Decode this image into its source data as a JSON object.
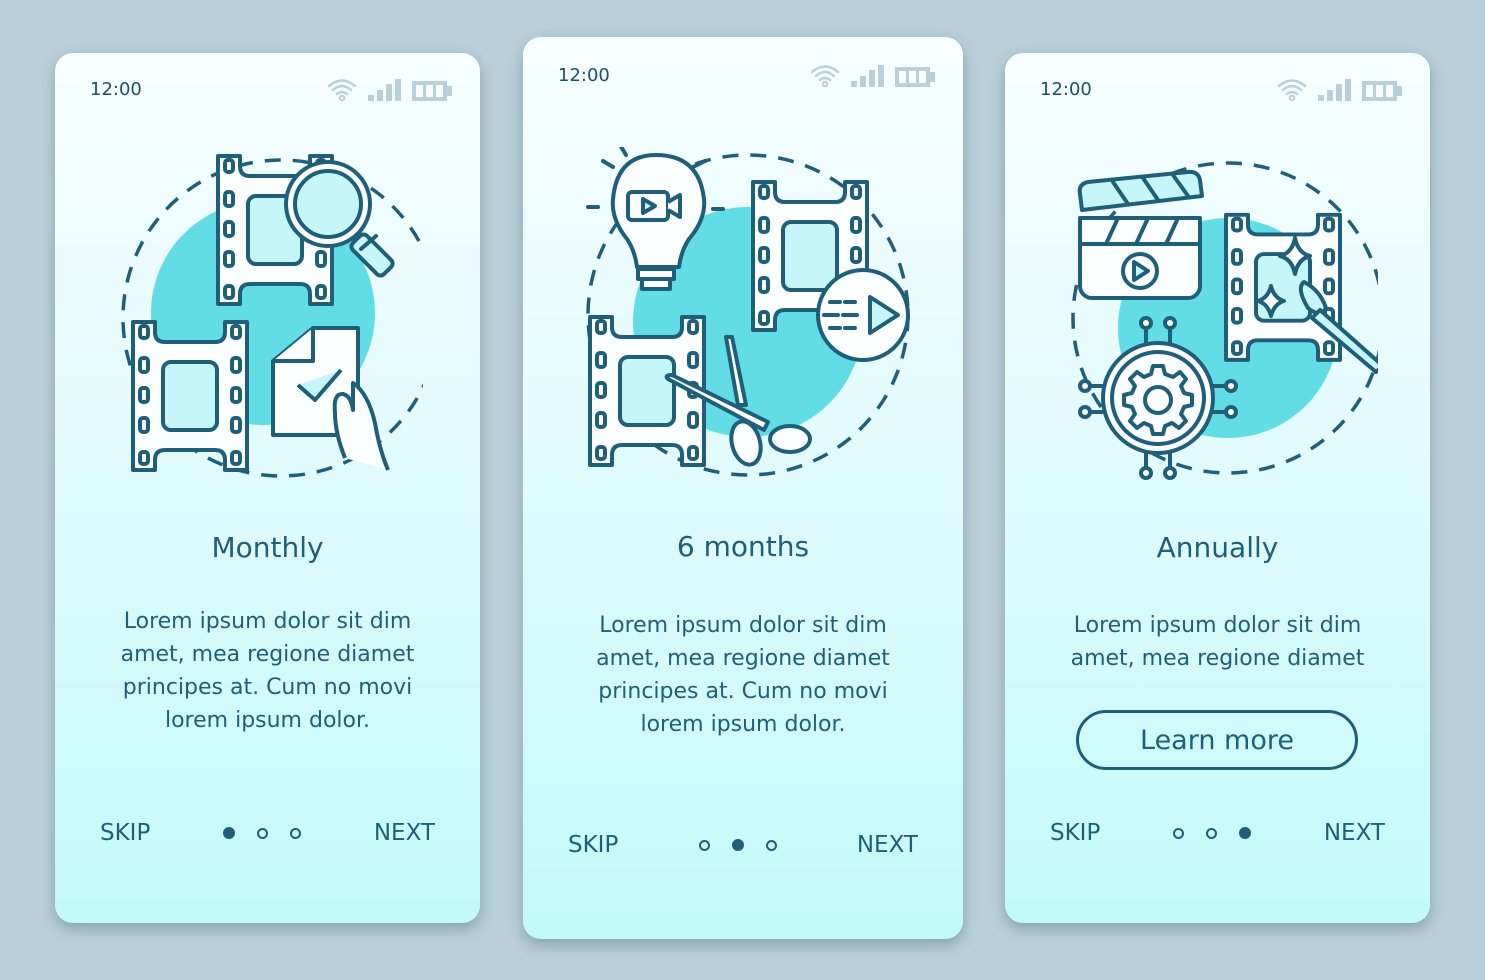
{
  "colors": {
    "background": "#b9cfd9",
    "accent": "#1f5f7a",
    "blob": "#62dde6",
    "card_bottom": "#c3f9fb",
    "status_icons": "#b9cfd9"
  },
  "screens": [
    {
      "status": {
        "time": "12:00",
        "icons": [
          "wifi-icon",
          "signal-icon",
          "battery-icon"
        ]
      },
      "illustration": [
        "film-strip-icon",
        "magnifier-icon",
        "film-strip-icon",
        "checked-document-icon",
        "hand-icon"
      ],
      "title": "Monthly",
      "body": [
        "Lorem ipsum dolor sit dim",
        "amet, mea regione diamet",
        "principes at. Cum no movi",
        "lorem ipsum dolor."
      ],
      "skip_label": "SKIP",
      "next_label": "NEXT",
      "active_page": 1,
      "page_count": 3
    },
    {
      "status": {
        "time": "12:00",
        "icons": [
          "wifi-icon",
          "signal-icon",
          "battery-icon"
        ]
      },
      "illustration": [
        "lightbulb-video-icon",
        "film-strip-icon",
        "play-button-icon",
        "film-strip-icon",
        "scissors-icon"
      ],
      "title": "6 months",
      "body": [
        "Lorem ipsum dolor sit dim",
        "amet, mea regione diamet",
        "principes at. Cum no movi",
        "lorem ipsum dolor."
      ],
      "skip_label": "SKIP",
      "next_label": "NEXT",
      "active_page": 2,
      "page_count": 3
    },
    {
      "status": {
        "time": "12:00",
        "icons": [
          "wifi-icon",
          "signal-icon",
          "battery-icon"
        ]
      },
      "illustration": [
        "clapperboard-icon",
        "film-strip-icon",
        "sparkle-icon",
        "paintbrush-icon",
        "gear-circuit-icon"
      ],
      "title": "Annually",
      "body": [
        "Lorem ipsum dolor sit dim",
        "amet, mea regione diamet"
      ],
      "button_label": "Learn more",
      "skip_label": "SKIP",
      "next_label": "NEXT",
      "active_page": 3,
      "page_count": 3
    }
  ]
}
